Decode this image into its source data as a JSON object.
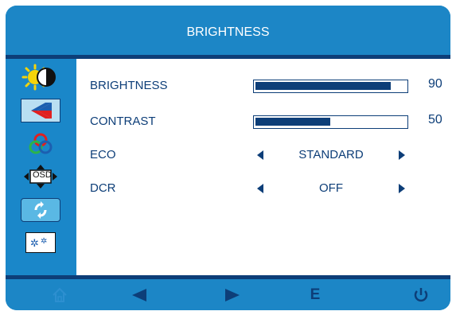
{
  "header": {
    "title": "BRIGHTNESS"
  },
  "sidebar": {
    "items": [
      {
        "icon": "brightness-contrast-icon",
        "selected": true
      },
      {
        "icon": "picture-icon"
      },
      {
        "icon": "color-icon"
      },
      {
        "icon": "osd-icon",
        "text": "OSD"
      },
      {
        "icon": "reset-icon"
      },
      {
        "icon": "misc-settings-icon"
      }
    ]
  },
  "settings": {
    "brightness": {
      "label": "BRIGHTNESS",
      "value": "90",
      "level": 0.9
    },
    "contrast": {
      "label": "CONTRAST",
      "value": "50",
      "level": 0.5
    },
    "eco": {
      "label": "ECO",
      "option": "STANDARD"
    },
    "dcr": {
      "label": "DCR",
      "option": "OFF"
    }
  },
  "footer": {
    "buttons": [
      {
        "icon": "home-icon"
      },
      {
        "icon": "left-arrow-icon"
      },
      {
        "icon": "right-arrow-icon"
      },
      {
        "icon": "enter-e-icon",
        "text": "E"
      },
      {
        "icon": "power-icon"
      }
    ]
  },
  "colors": {
    "panel": "#1c86c6",
    "dark": "#0d3e78",
    "tile": "#b9dff2"
  }
}
